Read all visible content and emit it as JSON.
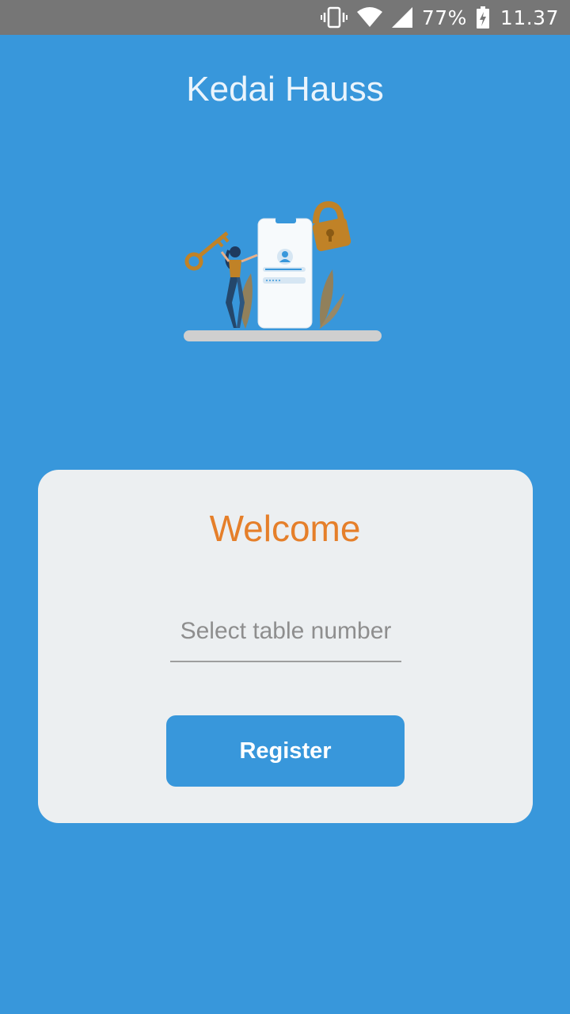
{
  "status_bar": {
    "battery_percent": "77%",
    "time": "11.37",
    "icons": [
      "vibrate-icon",
      "wifi-icon",
      "signal-icon",
      "battery-charging-icon"
    ]
  },
  "app": {
    "title": "Kedai Hauss"
  },
  "illustration": {
    "icon": "login-security-illustration",
    "colors": {
      "accent": "#C08227",
      "phone": "#F7FAFC",
      "base": "#CFCFCF",
      "blue": "#3897DB"
    }
  },
  "card": {
    "welcome": "Welcome",
    "table_input": {
      "placeholder": "Select table number",
      "value": ""
    },
    "register_label": "Register"
  },
  "colors": {
    "background": "#3897DB",
    "status_bar": "#767676",
    "card": "#ECEFF1",
    "welcome": "#E57F2A",
    "button": "#3897DB"
  }
}
